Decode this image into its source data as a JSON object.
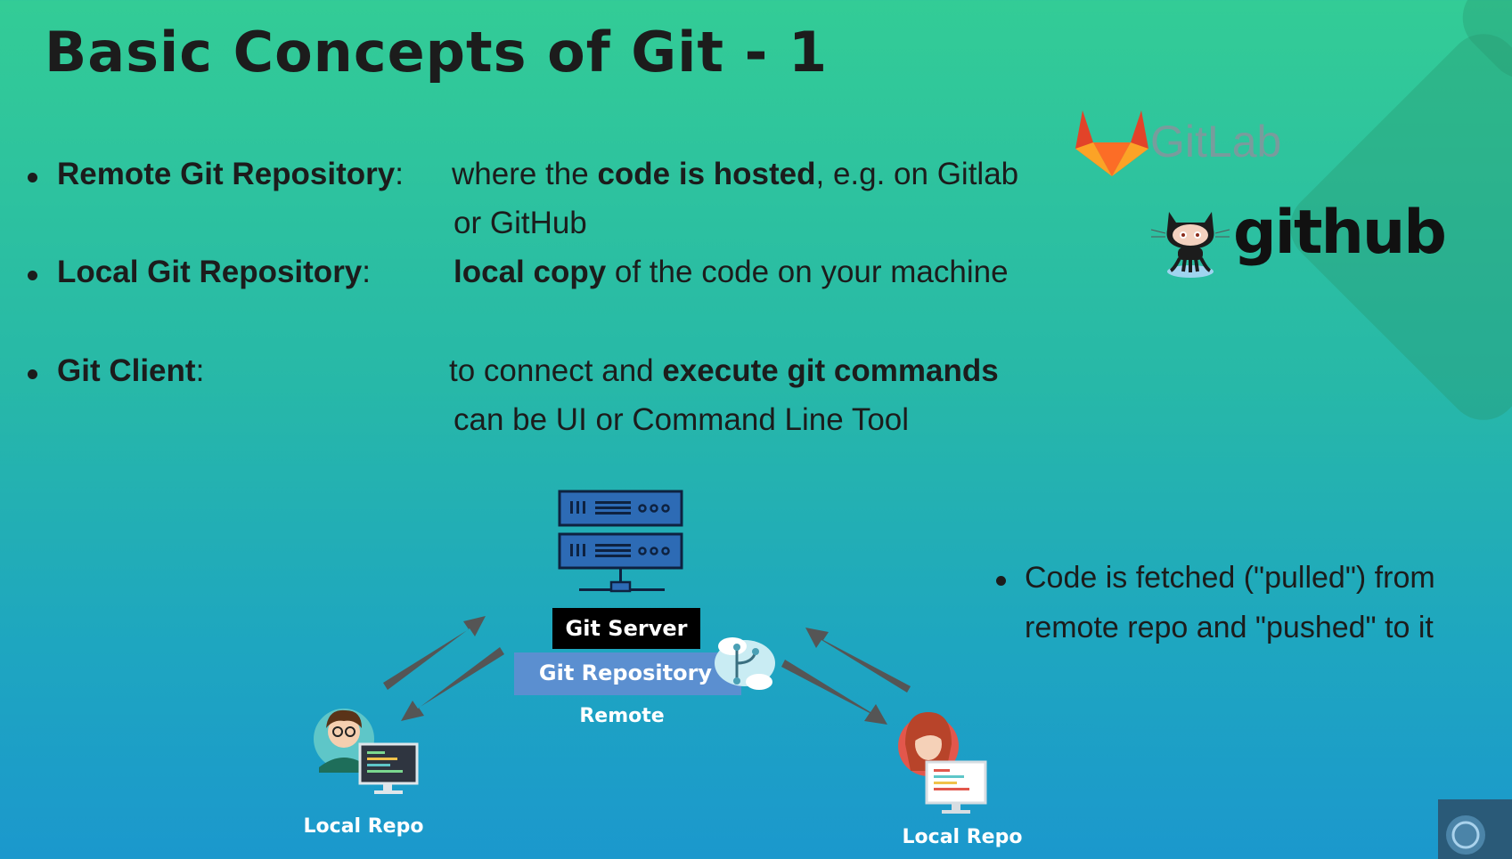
{
  "title": "Basic Concepts of Git - 1",
  "bullets": [
    {
      "label": "Remote Git Repository",
      "sep": ":",
      "pre": "where the ",
      "bold": "code is hosted",
      "post": ", e.g. on Gitlab",
      "line2": "or GitHub"
    },
    {
      "label": "Local Git Repository",
      "sep": ":",
      "pre": "",
      "bold": "local copy",
      "post": " of the code on your machine",
      "line2": ""
    },
    {
      "label": "Git Client",
      "sep": ":",
      "pre": "to connect and ",
      "bold": "execute git commands",
      "post": "",
      "line2": "can be UI or Command Line Tool"
    }
  ],
  "note": {
    "line1": "Code is fetched (\"pulled\") from",
    "line2": "remote repo and \"pushed\" to it"
  },
  "logos": {
    "gitlab": "GitLab",
    "github": "github"
  },
  "diagram": {
    "server_label": "Git Server",
    "repo_label": "Git Repository",
    "remote_label": "Remote",
    "local_left_label": "Local Repo",
    "local_right_label": "Local Repo"
  },
  "colors": {
    "text": "#1c1c1c",
    "server_blue": "#2d6bb5",
    "repo_blue": "#5b8fd0",
    "arrow": "#555555"
  }
}
